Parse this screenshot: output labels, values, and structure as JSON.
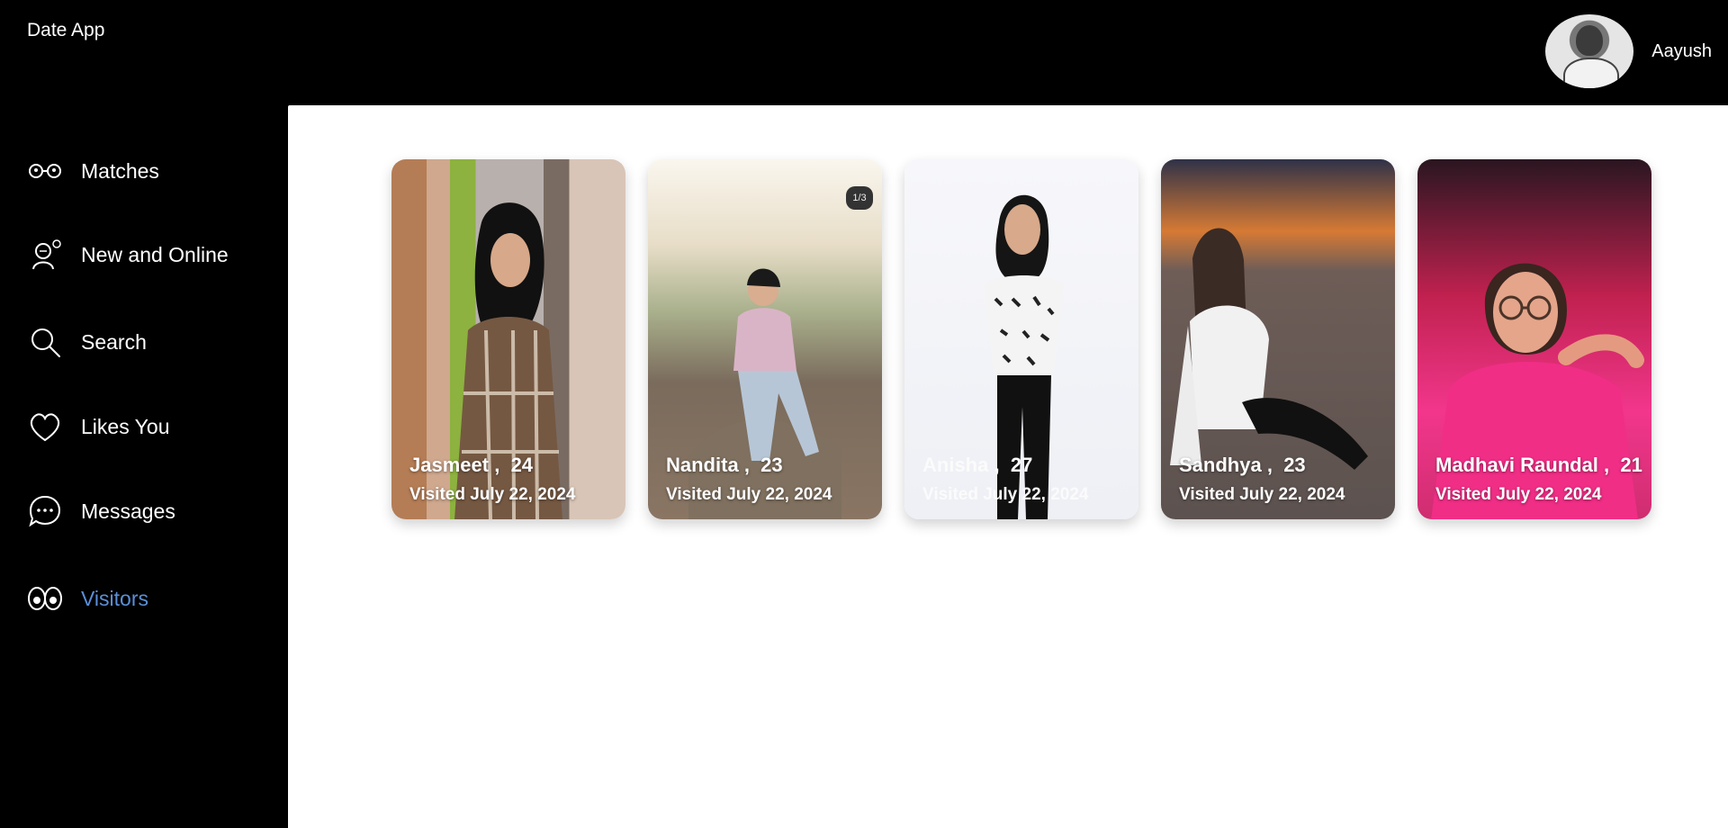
{
  "header": {
    "app_title": "Date App",
    "user_name": "Aayush"
  },
  "sidebar": {
    "items": [
      {
        "label": "Matches",
        "icon": "matches-icon",
        "active": false
      },
      {
        "label": "New and Online",
        "icon": "new-online-icon",
        "active": false
      },
      {
        "label": "Search",
        "icon": "search-icon",
        "active": false
      },
      {
        "label": "Likes You",
        "icon": "heart-icon",
        "active": false
      },
      {
        "label": "Messages",
        "icon": "chat-bubble-icon",
        "active": false
      },
      {
        "label": "Visitors",
        "icon": "eyes-icon",
        "active": true
      }
    ]
  },
  "visitors": [
    {
      "name": "Jasmeet",
      "separator": ",",
      "age": "24",
      "visited": "Visited July 22, 2024"
    },
    {
      "name": "Nandita",
      "separator": ",",
      "age": "23",
      "visited": "Visited July 22, 2024",
      "badge": "1/3"
    },
    {
      "name": "Anisha",
      "separator": ",",
      "age": "27",
      "visited": "Visited July 22, 2024"
    },
    {
      "name": "Sandhya",
      "separator": ",",
      "age": "23",
      "visited": "Visited July 22, 2024"
    },
    {
      "name": "Madhavi Raundal",
      "separator": ",",
      "age": "21",
      "visited": "Visited July 22, 2024"
    }
  ],
  "colors": {
    "background": "#000000",
    "content_background": "#ffffff",
    "active_nav": "#5b8fd8",
    "text": "#ffffff"
  }
}
